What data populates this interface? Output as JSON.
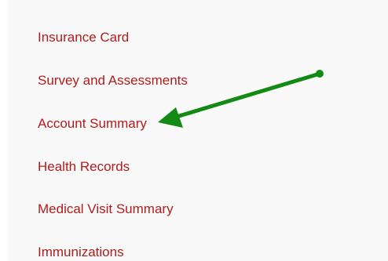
{
  "menu": {
    "items": [
      {
        "label": "Insurance Card"
      },
      {
        "label": "Survey and Assessments"
      },
      {
        "label": "Account Summary"
      },
      {
        "label": "Health Records"
      },
      {
        "label": "Medical Visit Summary"
      },
      {
        "label": "Immunizations"
      }
    ]
  },
  "colors": {
    "link": "#b31b1b",
    "panel_background": "#f9f9f9",
    "annotation_arrow": "#138a13"
  },
  "annotation": {
    "icon": "arrow-icon",
    "points_to": "Account Summary"
  }
}
